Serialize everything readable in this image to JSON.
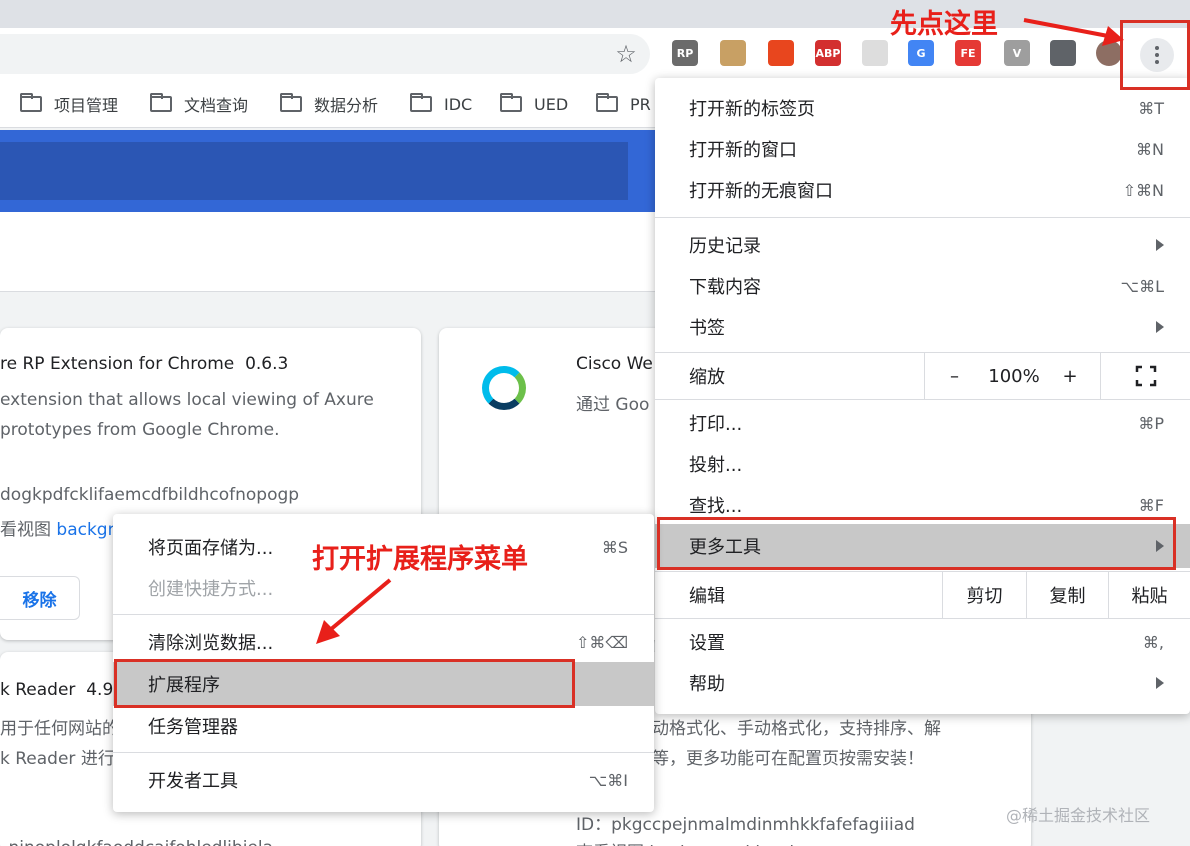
{
  "toolbar": {
    "extensions": [
      {
        "name": "axure-rp-extension-icon",
        "label": "RP",
        "color": "#6b6b6b"
      },
      {
        "name": "cat-extension-icon",
        "label": "",
        "color": "#c8a064"
      },
      {
        "name": "network-extension-icon",
        "label": "",
        "color": "#e8461e"
      },
      {
        "name": "adblock-plus-icon",
        "label": "ABP",
        "color": "#d32f2f"
      },
      {
        "name": "react-devtools-icon",
        "label": "",
        "color": "#dddddd"
      },
      {
        "name": "google-translate-icon",
        "label": "G",
        "color": "#4285f4"
      },
      {
        "name": "fe-helper-icon",
        "label": "FE",
        "color": "#e53935"
      },
      {
        "name": "vue-devtools-icon",
        "label": "V",
        "color": "#9e9e9e"
      },
      {
        "name": "puzzle-extensions-icon",
        "label": "",
        "color": "#5f6368"
      },
      {
        "name": "user-avatar-icon",
        "label": "",
        "color": "#8d6e63"
      }
    ]
  },
  "bookmarks": [
    {
      "label": "项目管理"
    },
    {
      "label": "文档查询"
    },
    {
      "label": "数据分析"
    },
    {
      "label": "IDC"
    },
    {
      "label": "UED"
    },
    {
      "label": "PR"
    }
  ],
  "cards": {
    "axure": {
      "title": "re RP Extension for Chrome",
      "version": "0.6.3",
      "desc_line1": "extension that allows local viewing of Axure",
      "desc_line2": "prototypes from Google Chrome.",
      "id": "dogkpdfcklifaemcdfbildhcofnopogp",
      "view_prefix": "看视图",
      "view_link": "backgro",
      "remove": "移除"
    },
    "cisco": {
      "title": "Cisco We",
      "desc": "通过 Goo"
    },
    "reader": {
      "title": "k Reader",
      "version": "4.9.",
      "line1": "用于任何网站的",
      "line2": "k Reader 进行"
    },
    "json": {
      "line1": "动格式化、手动格式化，支持排序、解",
      "line2": "等，更多功能可在配置页按需安装！",
      "id": "ID：pkgccpejnmalmdinmhkkfafefagiiiad",
      "view": "查看视图 background.html"
    },
    "bottom_text": "_ninoplolgkfaoddcaifohledljbiela"
  },
  "menu": {
    "new_tab": "打开新的标签页",
    "new_tab_sc": "⌘T",
    "new_window": "打开新的窗口",
    "new_window_sc": "⌘N",
    "incognito": "打开新的无痕窗口",
    "incognito_sc": "⇧⌘N",
    "history": "历史记录",
    "downloads": "下载内容",
    "downloads_sc": "⌥⌘L",
    "bookmarks": "书签",
    "zoom": "缩放",
    "zoom_minus": "–",
    "zoom_value": "100%",
    "zoom_plus": "+",
    "print": "打印...",
    "print_sc": "⌘P",
    "cast": "投射...",
    "find": "查找...",
    "find_sc": "⌘F",
    "more_tools": "更多工具",
    "edit": "编辑",
    "cut": "剪切",
    "copy": "复制",
    "paste": "粘贴",
    "settings": "设置",
    "settings_sc": "⌘,",
    "help": "帮助"
  },
  "submenu": {
    "save_page": "将页面存储为...",
    "save_page_sc": "⌘S",
    "create_shortcut": "创建快捷方式...",
    "clear_data": "清除浏览数据...",
    "clear_data_sc": "⇧⌘⌫",
    "extensions": "扩展程序",
    "task_manager": "任务管理器",
    "dev_tools": "开发者工具",
    "dev_tools_sc": "⌥⌘I"
  },
  "annotations": {
    "click_here": "先点这里",
    "open_ext_menu": "打开扩展程序菜单",
    "color": "#e8201a"
  },
  "watermark": "@稀土掘金技术社区"
}
